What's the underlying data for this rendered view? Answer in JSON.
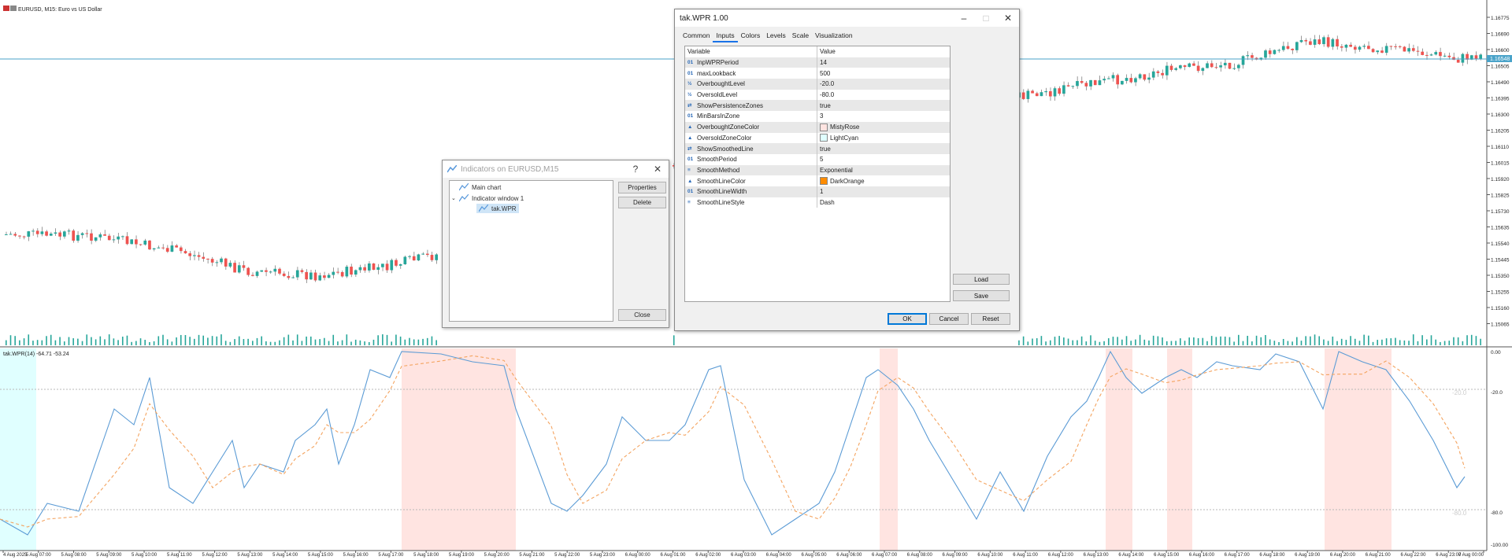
{
  "chart": {
    "symbol_title": "EURUSD, M15:  Euro vs US Dollar",
    "indicator_label": "tak.WPR(14) -64.71 -53.24",
    "price_axis": [
      "1.16775",
      "1.16690",
      "1.16600",
      "1.16505",
      "1.16490",
      "1.16395",
      "1.16300",
      "1.16205",
      "1.16110",
      "1.16015",
      "1.15920",
      "1.15825",
      "1.15730",
      "1.15635",
      "1.15540",
      "1.15445",
      "1.15350",
      "1.15255",
      "1.15160",
      "1.15065"
    ],
    "current_price": "1.16548",
    "wpr_axis": [
      "0.00",
      "-20.0",
      "-80.0",
      "-100.00"
    ],
    "time_axis": [
      "4 Aug 2025",
      "5 Aug 07:00",
      "5 Aug 08:00",
      "5 Aug 09:00",
      "5 Aug 10:00",
      "5 Aug 11:00",
      "5 Aug 12:00",
      "5 Aug 13:00",
      "5 Aug 14:00",
      "5 Aug 15:00",
      "5 Aug 16:00",
      "5 Aug 17:00",
      "5 Aug 18:00",
      "5 Aug 19:00",
      "5 Aug 20:00",
      "5 Aug 21:00",
      "5 Aug 22:00",
      "5 Aug 23:00",
      "6 Aug 00:00",
      "6 Aug 01:00",
      "6 Aug 02:00",
      "6 Aug 03:00",
      "6 Aug 04:00",
      "6 Aug 05:00",
      "6 Aug 06:00",
      "6 Aug 07:00",
      "6 Aug 08:00",
      "6 Aug 09:00",
      "6 Aug 10:00",
      "6 Aug 11:00",
      "6 Aug 12:00",
      "6 Aug 13:00",
      "6 Aug 14:00",
      "6 Aug 15:00",
      "6 Aug 16:00",
      "6 Aug 17:00",
      "6 Aug 18:00",
      "6 Aug 19:00",
      "6 Aug 20:00",
      "6 Aug 21:00",
      "6 Aug 22:00",
      "6 Aug 23:00",
      "7 Aug 00:00"
    ],
    "colors": {
      "bull": "#26a69a",
      "bear": "#ef5350",
      "wpr": "#5b9bd5",
      "smooth": "#f4a460",
      "overbought": "#ffe4e1",
      "oversold": "#e0ffff",
      "grid": "#b8b8b8"
    }
  },
  "indicators_dialog": {
    "title": "Indicators on EURUSD,M15",
    "help": "?",
    "close_x": "✕",
    "tree": [
      "Main chart",
      "Indicator window 1",
      "tak.WPR"
    ],
    "buttons": {
      "properties": "Properties",
      "delete": "Delete",
      "close": "Close"
    }
  },
  "props_dialog": {
    "title": "tak.WPR 1.00",
    "tabs": [
      "Common",
      "Inputs",
      "Colors",
      "Levels",
      "Scale",
      "Visualization"
    ],
    "active_tab": "Inputs",
    "col_variable": "Variable",
    "col_value": "Value",
    "rows": [
      {
        "icon": "01",
        "name": "InpWPRPeriod",
        "value": "14"
      },
      {
        "icon": "01",
        "name": "maxLookback",
        "value": "500"
      },
      {
        "icon": "½",
        "name": "OverboughtLevel",
        "value": "-20.0"
      },
      {
        "icon": "½",
        "name": "OversoldLevel",
        "value": "-80.0"
      },
      {
        "icon": "⇄",
        "name": "ShowPersistenceZones",
        "value": "true"
      },
      {
        "icon": "01",
        "name": "MinBarsInZone",
        "value": "3"
      },
      {
        "icon": "▲",
        "name": "OverboughtZoneColor",
        "value": "MistyRose",
        "swatch": "#ffe4e1"
      },
      {
        "icon": "▲",
        "name": "OversoldZoneColor",
        "value": "LightCyan",
        "swatch": "#e0ffff"
      },
      {
        "icon": "⇄",
        "name": "ShowSmoothedLine",
        "value": "true"
      },
      {
        "icon": "01",
        "name": "SmoothPeriod",
        "value": "5"
      },
      {
        "icon": "≡",
        "name": "SmoothMethod",
        "value": "Exponential"
      },
      {
        "icon": "▲",
        "name": "SmoothLineColor",
        "value": "DarkOrange",
        "swatch": "#ff8c00"
      },
      {
        "icon": "01",
        "name": "SmoothLineWidth",
        "value": "1"
      },
      {
        "icon": "≡",
        "name": "SmoothLineStyle",
        "value": "Dash"
      }
    ],
    "buttons": {
      "load": "Load",
      "save": "Save",
      "ok": "OK",
      "cancel": "Cancel",
      "reset": "Reset"
    }
  }
}
